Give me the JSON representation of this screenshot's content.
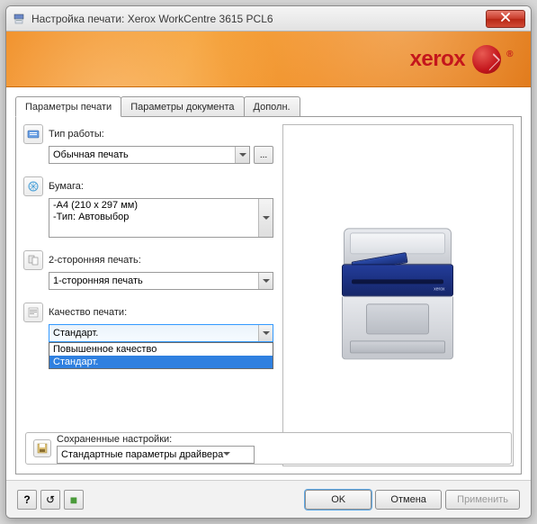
{
  "window": {
    "title": "Настройка печати: Xerox WorkCentre 3615 PCL6"
  },
  "brand": {
    "name": "xerox"
  },
  "tabs": [
    {
      "label": "Параметры печати",
      "active": true
    },
    {
      "label": "Параметры документа"
    },
    {
      "label": "Дополн."
    }
  ],
  "jobtype": {
    "label": "Тип работы:",
    "value": "Обычная печать",
    "more": "..."
  },
  "paper": {
    "label": "Бумага:",
    "line1": "-A4 (210 x 297 мм)",
    "line2": "-Тип: Автовыбор"
  },
  "duplex": {
    "label": "2-сторонняя печать:",
    "value": "1-сторонняя печать"
  },
  "quality": {
    "label": "Качество печати:",
    "value": "Стандарт.",
    "options": [
      {
        "label": "Повышенное качество",
        "selected": false
      },
      {
        "label": "Стандарт.",
        "selected": true
      }
    ]
  },
  "saved": {
    "label": "Сохраненные настройки:",
    "value": "Стандартные параметры драйвера"
  },
  "footer": {
    "help": "?",
    "reset": "↺",
    "eco": "■",
    "ok": "OK",
    "cancel": "Отмена",
    "apply": "Применить"
  },
  "printer_badge": "xerox"
}
